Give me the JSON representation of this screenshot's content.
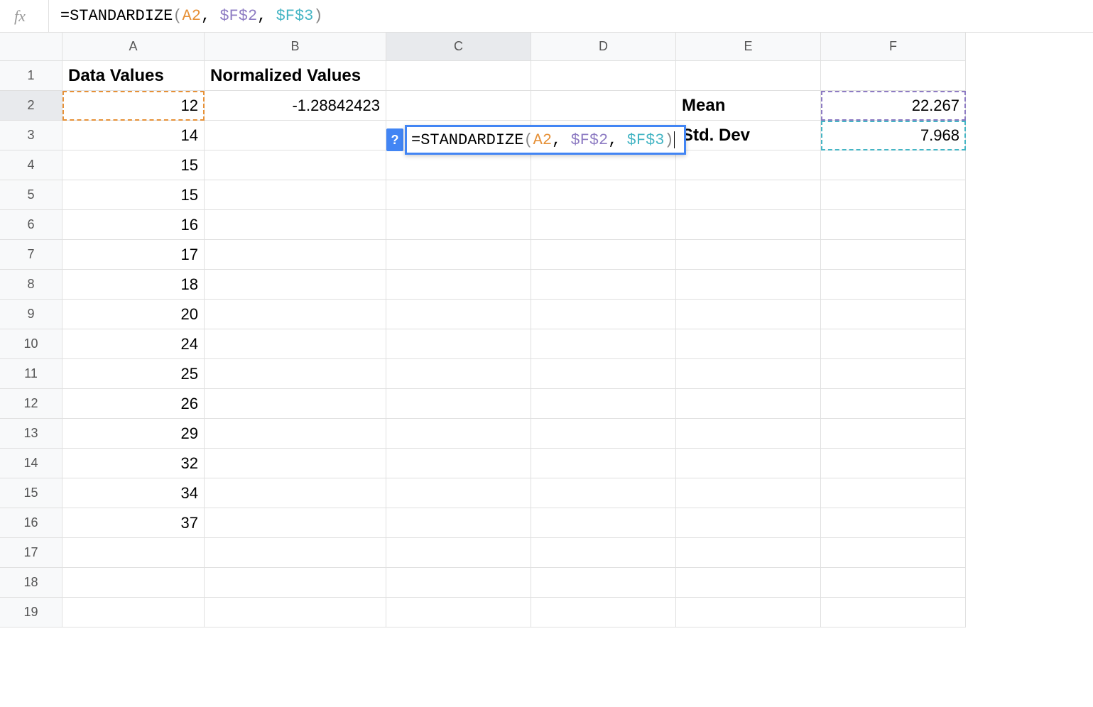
{
  "formulaBar": {
    "prefix": "=STANDARDIZE",
    "arg1": "A2",
    "arg2": "$F$2",
    "arg3": "$F$3"
  },
  "columns": [
    "A",
    "B",
    "C",
    "D",
    "E",
    "F"
  ],
  "rowCount": 19,
  "headers": {
    "A1": "Data Values",
    "B1": "Normalized Values"
  },
  "dataA": [
    "12",
    "14",
    "15",
    "15",
    "16",
    "17",
    "18",
    "20",
    "24",
    "25",
    "26",
    "29",
    "32",
    "34",
    "37"
  ],
  "B2": "-1.28842423",
  "E2": "Mean",
  "E3": "Std. Dev",
  "F2": "22.267",
  "F3": "7.968",
  "editingCell": {
    "helpBadge": "?",
    "prefix": "=STANDARDIZE",
    "arg1": "A2",
    "arg2": "$F$2",
    "arg3": "$F$3"
  }
}
